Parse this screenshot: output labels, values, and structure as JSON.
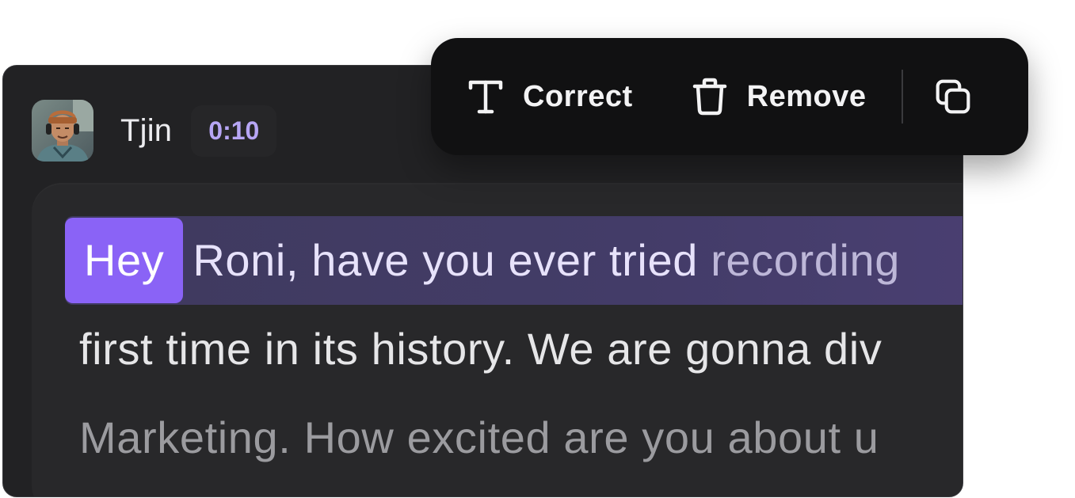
{
  "speaker": {
    "name": "Tjin",
    "timestamp": "0:10",
    "avatar_icon": "person-avatar"
  },
  "transcript": {
    "highlighted_word": "Hey",
    "line_1_main": "Roni, have you ever tried",
    "line_1_faded": "recording",
    "line_2": "first time in its history. We are gonna div",
    "line_3": "Marketing.  How excited are you about u"
  },
  "toolbar": {
    "correct_label": "Correct",
    "correct_icon": "text-t-icon",
    "remove_label": "Remove",
    "remove_icon": "trash-icon",
    "copy_icon": "copy-icon"
  },
  "colors": {
    "accent": "#8a63f6",
    "timestamp": "#b7a6f5",
    "panel_bg": "#222224",
    "toolbar_bg": "#111112"
  }
}
